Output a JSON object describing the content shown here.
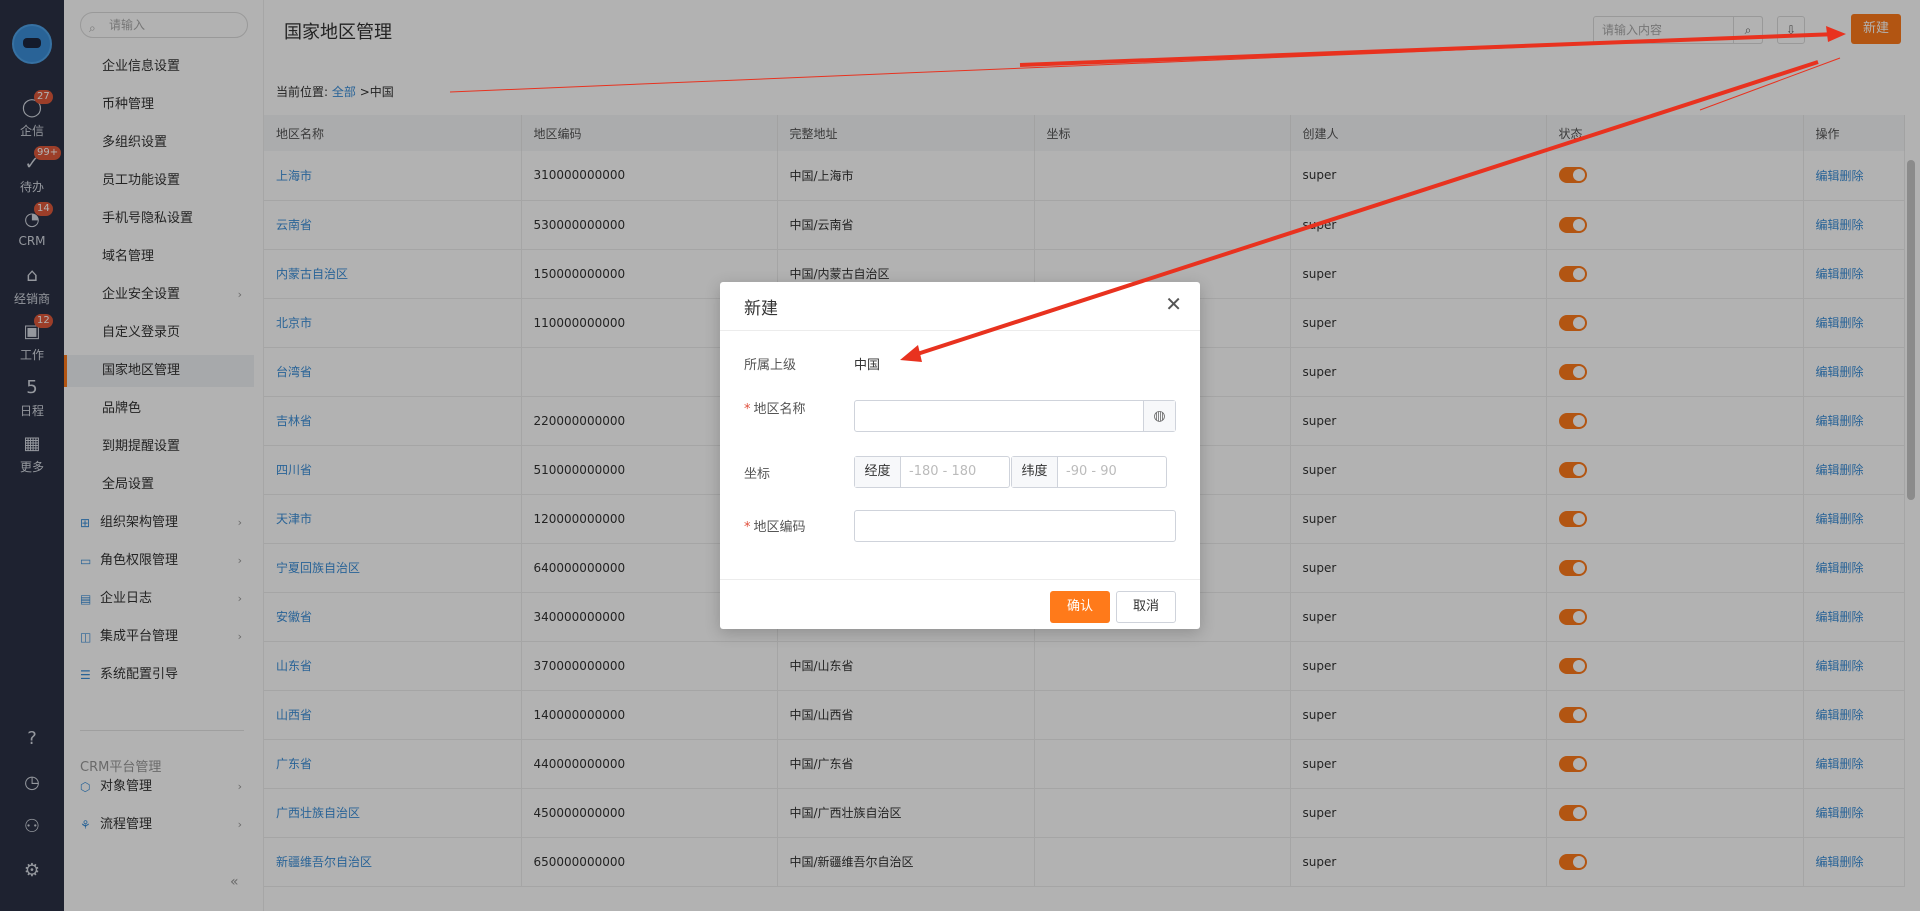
{
  "rail": {
    "items": [
      {
        "label": "企信",
        "badge": "27",
        "icon": "chat-icon"
      },
      {
        "label": "待办",
        "badge": "99+",
        "icon": "check-circle-icon"
      },
      {
        "label": "CRM",
        "badge": "14",
        "icon": "chart-icon"
      },
      {
        "label": "经销商",
        "badge": "",
        "icon": "store-icon"
      },
      {
        "label": "工作",
        "badge": "12",
        "icon": "briefcase-icon"
      },
      {
        "label": "日程",
        "badge": "",
        "icon": "calendar-icon"
      },
      {
        "label": "更多",
        "badge": "",
        "icon": "grid-icon"
      }
    ]
  },
  "sidebar": {
    "search_placeholder": "请输入",
    "items": [
      {
        "label": "企业信息设置"
      },
      {
        "label": "币种管理"
      },
      {
        "label": "多组织设置"
      },
      {
        "label": "员工功能设置"
      },
      {
        "label": "手机号隐私设置"
      },
      {
        "label": "域名管理"
      },
      {
        "label": "企业安全设置"
      },
      {
        "label": "自定义登录页"
      },
      {
        "label": "国家地区管理"
      },
      {
        "label": "品牌色"
      },
      {
        "label": "到期提醒设置"
      },
      {
        "label": "全局设置"
      }
    ],
    "groups": [
      {
        "label": "组织架构管理"
      },
      {
        "label": "角色权限管理"
      },
      {
        "label": "企业日志"
      },
      {
        "label": "集成平台管理"
      },
      {
        "label": "系统配置引导"
      }
    ],
    "section": "CRM平台管理",
    "crm_groups": [
      {
        "label": "对象管理"
      },
      {
        "label": "流程管理"
      }
    ]
  },
  "header": {
    "title": "国家地区管理",
    "search_placeholder": "请输入内容",
    "new_button": "新建"
  },
  "breadcrumb": {
    "prefix": "当前位置:",
    "root": "全部",
    "sep": ">",
    "current": "中国"
  },
  "table": {
    "columns": [
      "地区名称",
      "地区编码",
      "完整地址",
      "坐标",
      "创建人",
      "状态",
      "操作"
    ],
    "edit_label": "编辑",
    "delete_label": "删除",
    "rows": [
      {
        "name": "上海市",
        "code": "310000000000",
        "address": "中国/上海市",
        "coord": "",
        "creator": "super"
      },
      {
        "name": "云南省",
        "code": "530000000000",
        "address": "中国/云南省",
        "coord": "",
        "creator": "super"
      },
      {
        "name": "内蒙古自治区",
        "code": "150000000000",
        "address": "中国/内蒙古自治区",
        "coord": "",
        "creator": "super"
      },
      {
        "name": "北京市",
        "code": "110000000000",
        "address": "",
        "coord": "",
        "creator": "super"
      },
      {
        "name": "台湾省",
        "code": "",
        "address": "",
        "coord": "",
        "creator": "super"
      },
      {
        "name": "吉林省",
        "code": "220000000000",
        "address": "",
        "coord": "",
        "creator": "super"
      },
      {
        "name": "四川省",
        "code": "510000000000",
        "address": "",
        "coord": "",
        "creator": "super"
      },
      {
        "name": "天津市",
        "code": "120000000000",
        "address": "",
        "coord": "",
        "creator": "super"
      },
      {
        "name": "宁夏回族自治区",
        "code": "640000000000",
        "address": "",
        "coord": "",
        "creator": "super"
      },
      {
        "name": "安徽省",
        "code": "340000000000",
        "address": "",
        "coord": "",
        "creator": "super"
      },
      {
        "name": "山东省",
        "code": "370000000000",
        "address": "中国/山东省",
        "coord": "",
        "creator": "super"
      },
      {
        "name": "山西省",
        "code": "140000000000",
        "address": "中国/山西省",
        "coord": "",
        "creator": "super"
      },
      {
        "name": "广东省",
        "code": "440000000000",
        "address": "中国/广东省",
        "coord": "",
        "creator": "super"
      },
      {
        "name": "广西壮族自治区",
        "code": "450000000000",
        "address": "中国/广西壮族自治区",
        "coord": "",
        "creator": "super"
      },
      {
        "name": "新疆维吾尔自治区",
        "code": "650000000000",
        "address": "中国/新疆维吾尔自治区",
        "coord": "",
        "creator": "super"
      }
    ]
  },
  "modal": {
    "title": "新建",
    "parent_label": "所属上级",
    "parent_value": "中国",
    "name_label": "地区名称",
    "coord_label": "坐标",
    "lng_label": "经度",
    "lng_placeholder": "-180 - 180",
    "lat_label": "纬度",
    "lat_placeholder": "-90 - 90",
    "code_label": "地区编码",
    "ok_label": "确认",
    "cancel_label": "取消"
  },
  "colors": {
    "accent": "#ff7a1a",
    "link": "#3b8fd8",
    "rail_bg": "#2b3245",
    "annotation_arrow": "#e8321f"
  }
}
